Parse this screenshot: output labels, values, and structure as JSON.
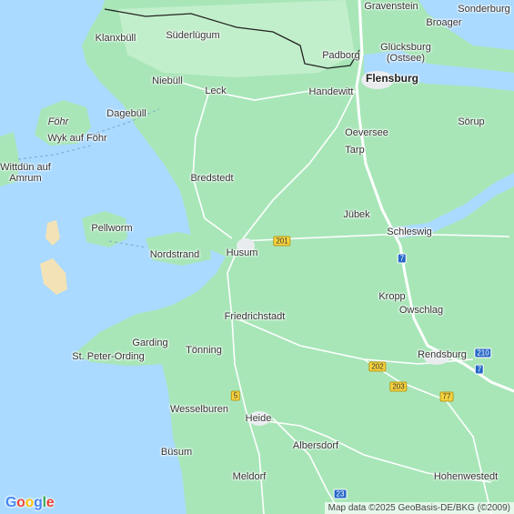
{
  "colors": {
    "water": "#aadaff",
    "land": "#a8e6b8",
    "land_light": "#c2efcb",
    "road": "#ffffff",
    "highway": "#a4b3c0",
    "border": "#222222"
  },
  "places": {
    "gravenstein": "Gravenstein",
    "sonderburg": "Sonderburg",
    "broager": "Broager",
    "klanxbull": "Klanxbüll",
    "suderlugum": "Süderlügum",
    "padborg": "Padborg",
    "glucksburg": "Glücksburg\n(Ostsee)",
    "niebull": "Niebüll",
    "flensburg": "Flensburg",
    "leck": "Leck",
    "handewitt": "Handewitt",
    "fohr": "Föhr",
    "dagebull": "Dagebüll",
    "sorup": "Sörup",
    "wyk": "Wyk auf Föhr",
    "oeversee": "Oeversee",
    "tarp": "Tarp",
    "wittdun": "Wittdün auf\nAmrum",
    "bredstedt": "Bredstedt",
    "jubek": "Jübek",
    "pellworm": "Pellworm",
    "schleswig": "Schleswig",
    "husum": "Husum",
    "nordstrand": "Nordstrand",
    "kropp": "Kropp",
    "friedrichstadt": "Friedrichstadt",
    "owschlag": "Owschlag",
    "garding": "Garding",
    "tonning": "Tönning",
    "stpeter": "St. Peter-Ording",
    "rendsburg": "Rendsburg",
    "wesselburen": "Wesselburen",
    "heide": "Heide",
    "albersdorf": "Albersdorf",
    "busum": "Büsum",
    "hohenwestedt": "Hohenwestedt",
    "meldorf": "Meldorf"
  },
  "shields": {
    "r201": "201",
    "a7a": "7",
    "r210": "210",
    "a7b": "7",
    "r202": "202",
    "r203": "203",
    "r5": "5",
    "r77": "77",
    "a23": "23"
  },
  "logo": {
    "g1": "G",
    "g2": "o",
    "g3": "o",
    "g4": "g",
    "g5": "l",
    "g6": "e"
  },
  "attribution": "Map data ©2025 GeoBasis-DE/BKG (©2009)"
}
